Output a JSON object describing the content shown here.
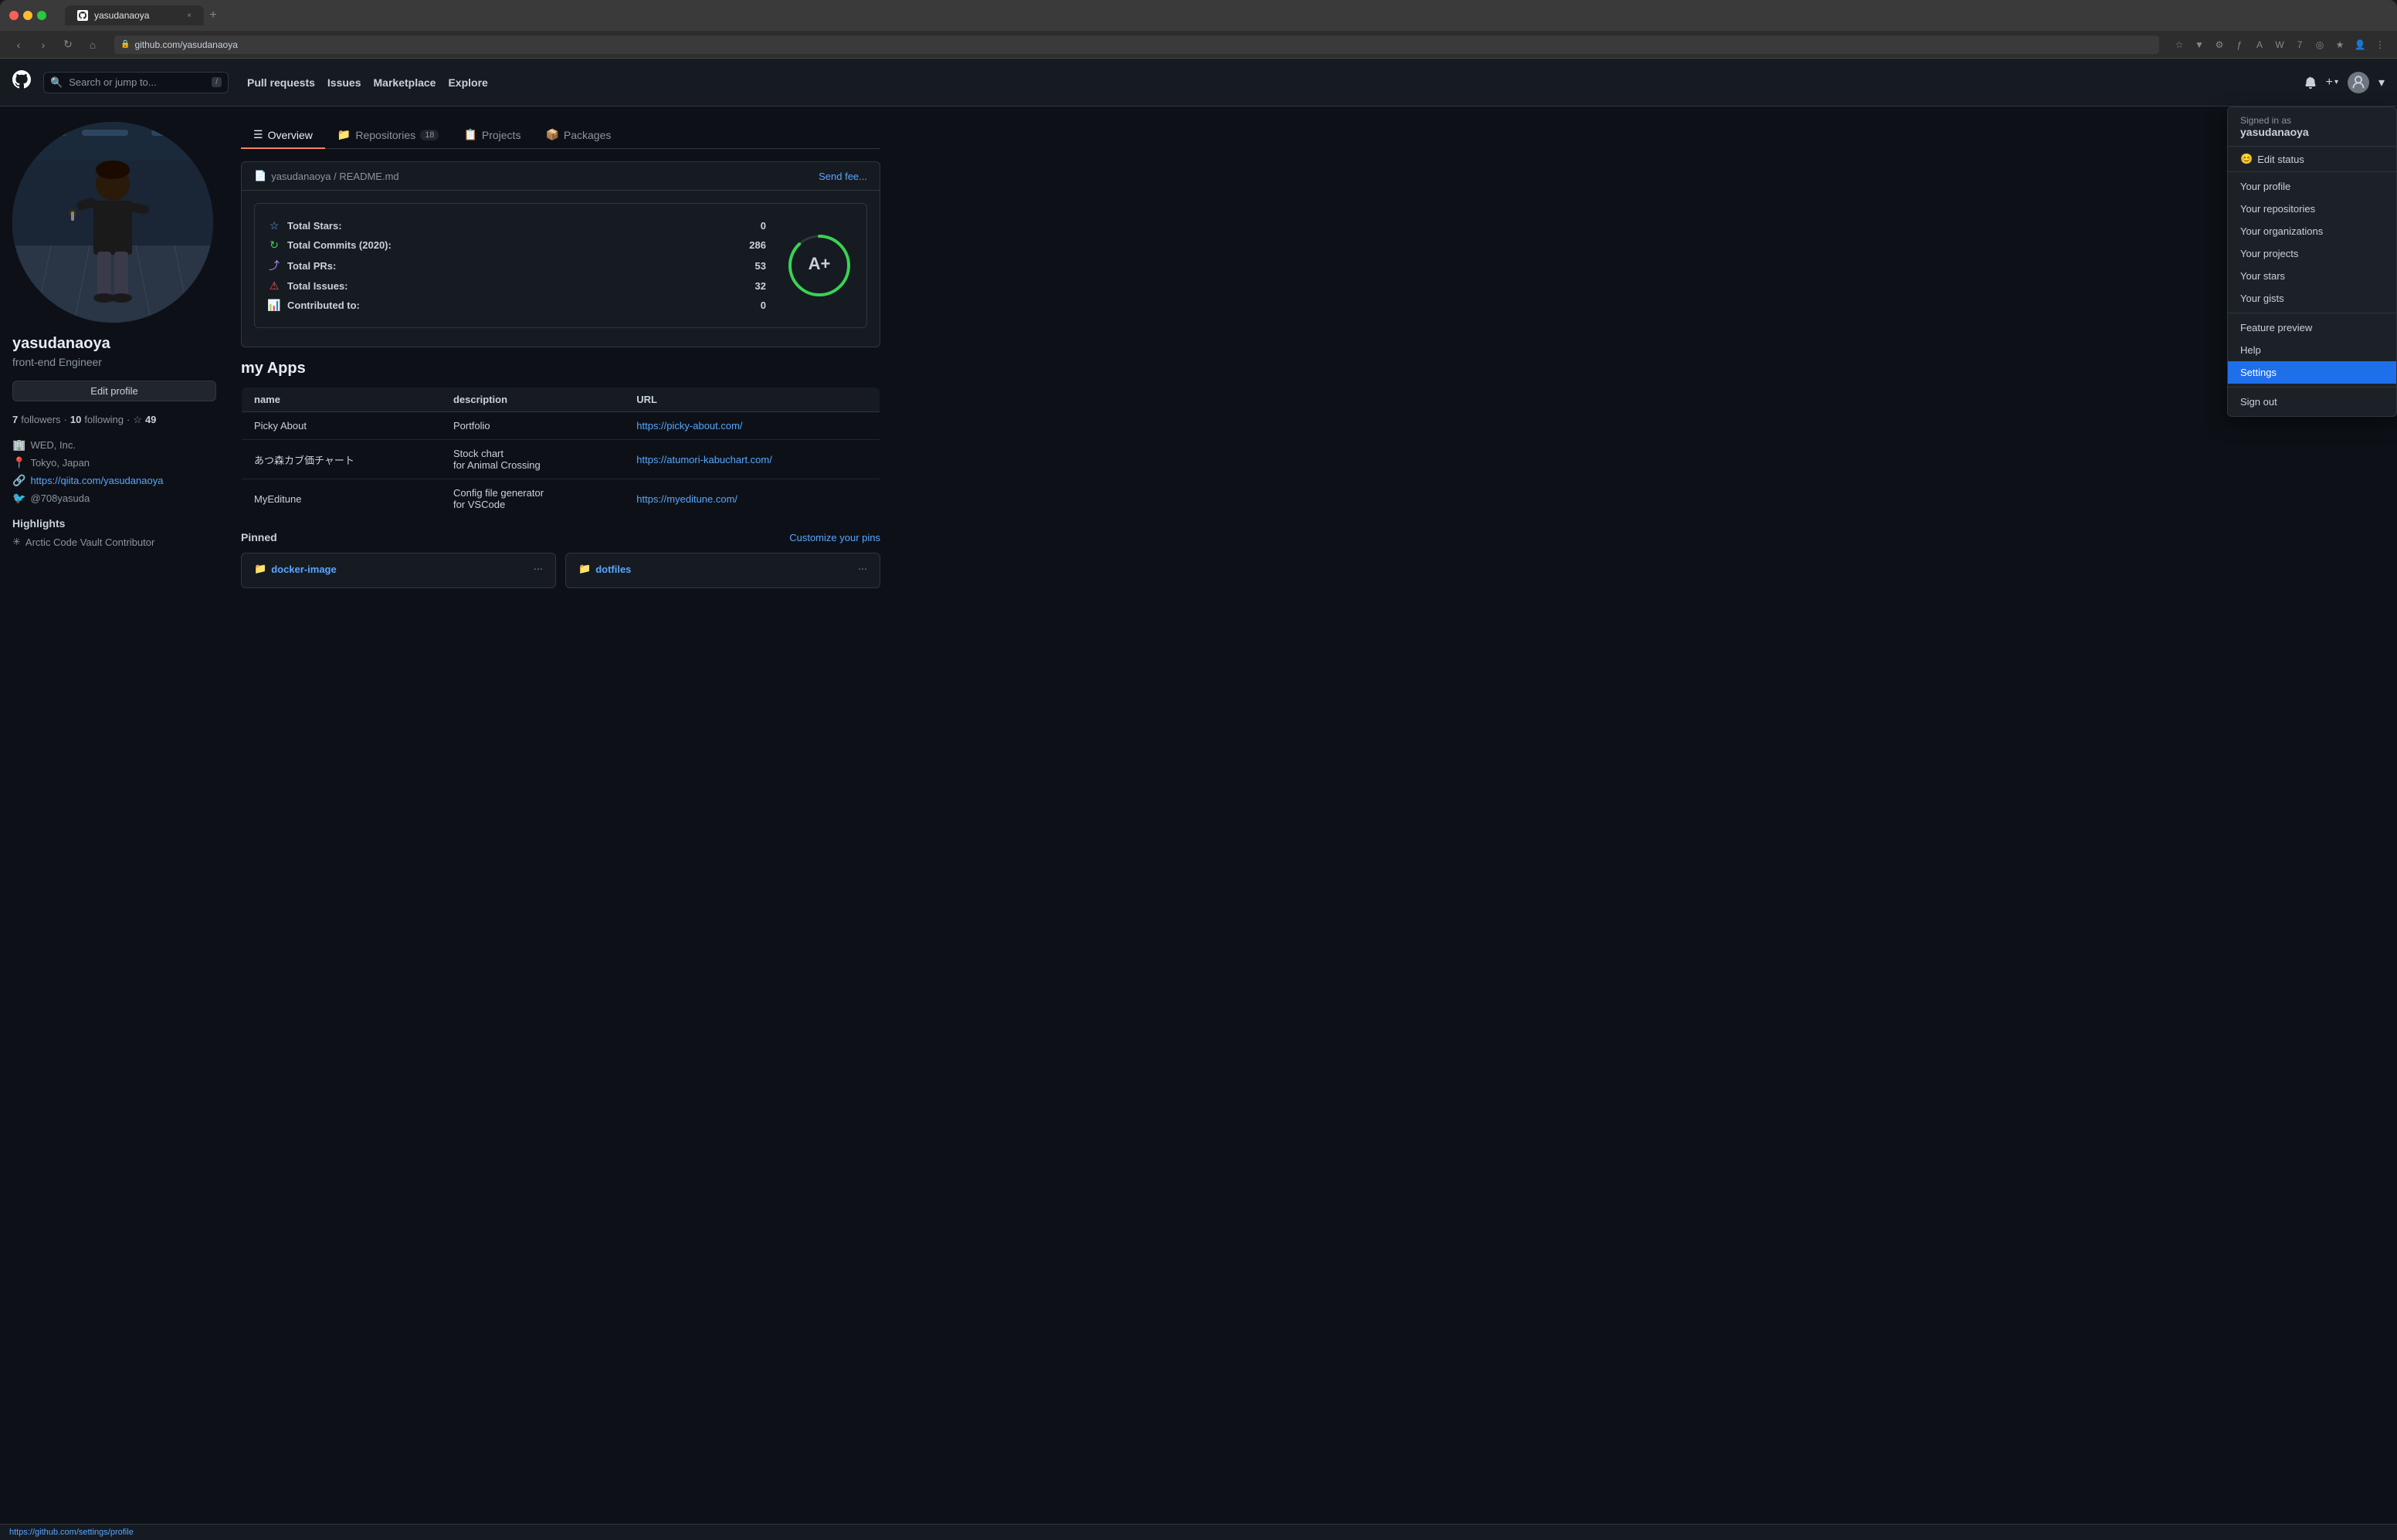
{
  "browser": {
    "tab_title": "yasudanaoya",
    "url": "github.com/yasudanaoya",
    "tab_close": "×",
    "tab_add": "+",
    "nav_back": "‹",
    "nav_forward": "›",
    "nav_refresh": "↻",
    "nav_home": "⌂"
  },
  "header": {
    "logo": "●",
    "search_placeholder": "Search or jump to...",
    "search_kbd": "/",
    "nav_items": [
      {
        "label": "Pull requests",
        "key": "pull-requests"
      },
      {
        "label": "Issues",
        "key": "issues"
      },
      {
        "label": "Marketplace",
        "key": "marketplace"
      },
      {
        "label": "Explore",
        "key": "explore"
      }
    ],
    "notification_icon": "🔔",
    "plus_icon": "+",
    "caret_icon": "▾"
  },
  "dropdown": {
    "signed_in_label": "Signed in as",
    "username": "yasudanaoya",
    "edit_status_label": "Edit status",
    "items": [
      {
        "label": "Your profile",
        "key": "your-profile",
        "active": false
      },
      {
        "label": "Your repositories",
        "key": "your-repositories",
        "active": false
      },
      {
        "label": "Your organizations",
        "key": "your-organizations",
        "active": false
      },
      {
        "label": "Your projects",
        "key": "your-projects",
        "active": false
      },
      {
        "label": "Your stars",
        "key": "your-stars",
        "active": false
      },
      {
        "label": "Your gists",
        "key": "your-gists",
        "active": false
      }
    ],
    "feature_preview": "Feature preview",
    "help": "Help",
    "settings": "Settings",
    "sign_out": "Sign out"
  },
  "profile": {
    "username": "yasudanaoya",
    "title": "front-end Engineer",
    "edit_profile_btn": "Edit profile",
    "followers": "7",
    "following": "10",
    "stars": "49",
    "followers_label": "followers",
    "following_label": "following",
    "meta": {
      "company": "WED, Inc.",
      "location": "Tokyo, Japan",
      "website": "https://qiita.com/yasudanaoya",
      "twitter": "@708yasuda"
    },
    "highlights_title": "Highlights",
    "highlight_item": "Arctic Code Vault Contributor"
  },
  "tabs": [
    {
      "label": "Overview",
      "key": "overview",
      "active": true,
      "badge": null
    },
    {
      "label": "Repositories",
      "key": "repositories",
      "active": false,
      "badge": "18"
    },
    {
      "label": "Projects",
      "key": "projects",
      "active": false,
      "badge": null
    },
    {
      "label": "Packages",
      "key": "packages",
      "active": false,
      "badge": null
    }
  ],
  "readme": {
    "path": "yasudanaoya / README.md",
    "send_feedback": "Send fee...",
    "path_icon": "📄"
  },
  "stats": {
    "total_stars_label": "Total Stars:",
    "total_stars_value": "0",
    "total_commits_label": "Total Commits (2020):",
    "total_commits_value": "286",
    "total_prs_label": "Total PRs:",
    "total_prs_value": "53",
    "total_issues_label": "Total Issues:",
    "total_issues_value": "32",
    "contributed_label": "Contributed to:",
    "contributed_value": "0",
    "grade": "A+",
    "grade_color": "#39d353",
    "grade_bg": "#161b22"
  },
  "apps": {
    "title": "my Apps",
    "headers": [
      "name",
      "description",
      "URL"
    ],
    "rows": [
      {
        "name": "Picky About",
        "description": "Portfolio",
        "url": "https://picky-about.com/"
      },
      {
        "name": "あつ森カブ価チャート",
        "description": "Stock chart\nfor Animal Crossing",
        "url": "https://atumori-kabuchart.com/"
      },
      {
        "name": "MyEditune",
        "description": "Config file generator\nfor VSCode",
        "url": "https://myeditune.com/"
      }
    ]
  },
  "pinned": {
    "title": "Pinned",
    "customize_label": "Customize your pins",
    "items": [
      {
        "name": "docker-image",
        "key": "docker-image"
      },
      {
        "name": "dotfiles",
        "key": "dotfiles"
      }
    ]
  },
  "status_bar": {
    "url": "https://github.com/settings/profile"
  }
}
